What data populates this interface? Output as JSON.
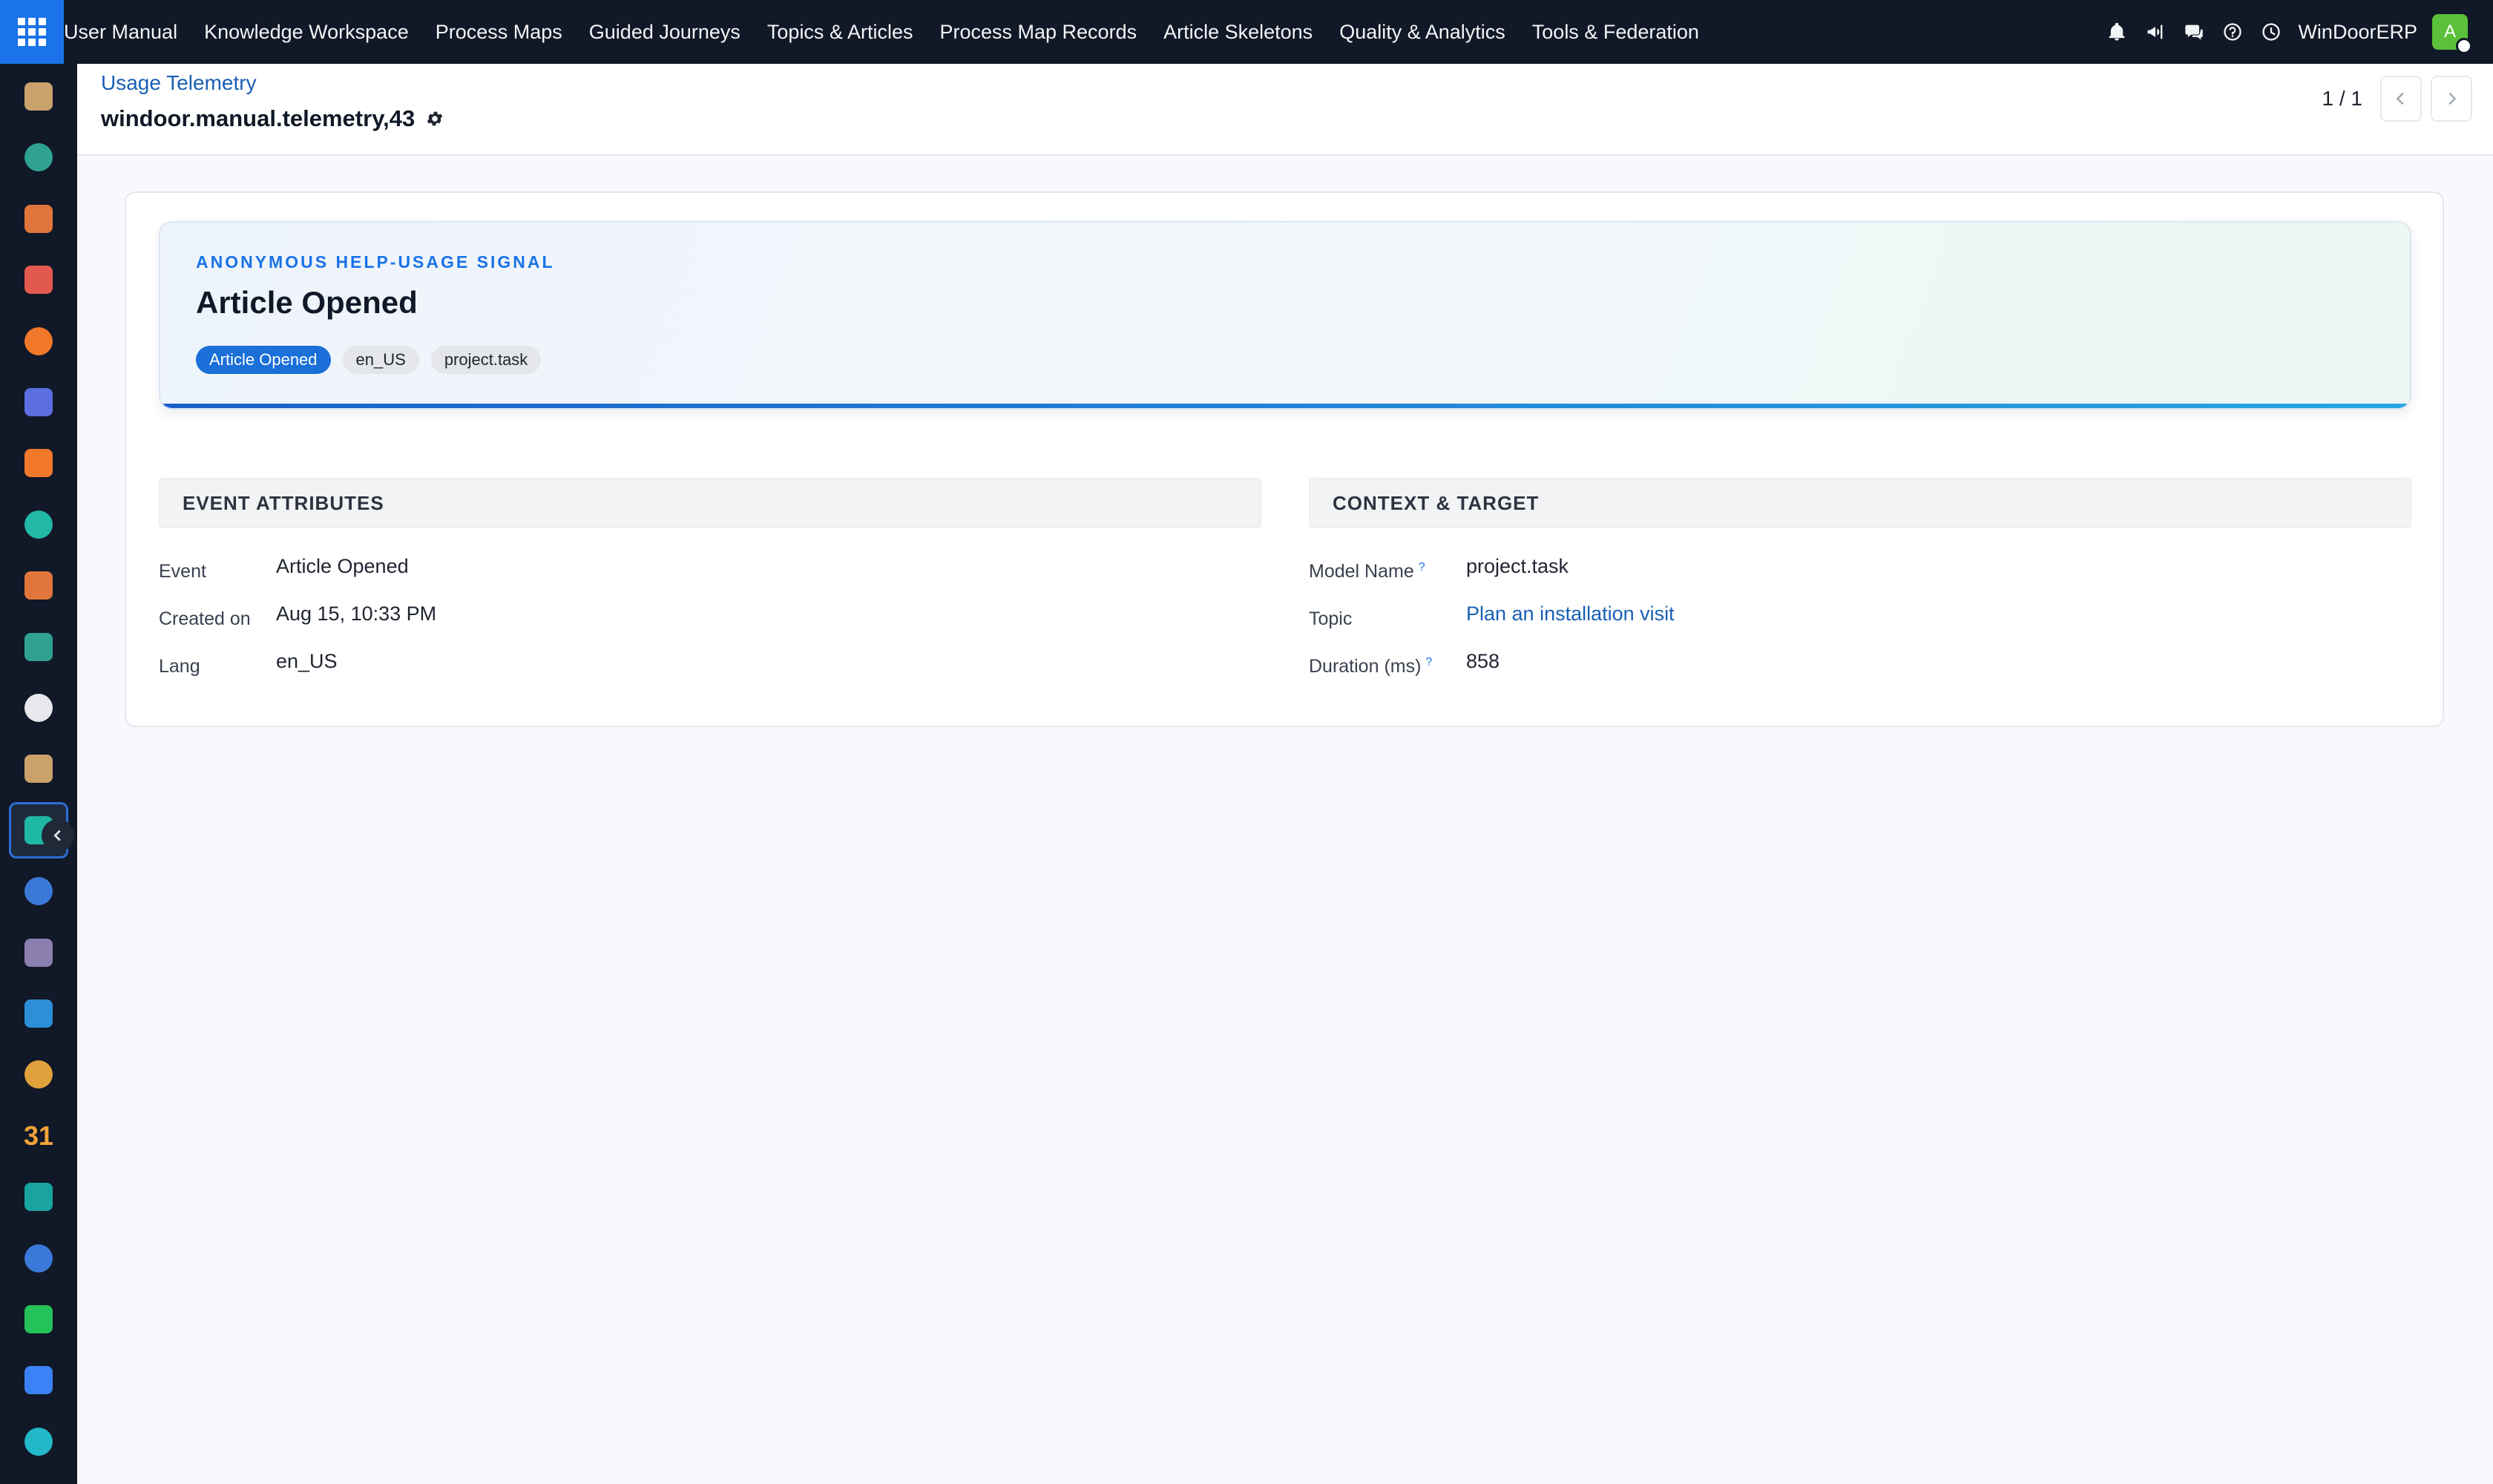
{
  "topbar": {
    "apps_icon": "apps-grid-icon",
    "brand": "User Manual",
    "menu": [
      {
        "label": "Knowledge Workspace"
      },
      {
        "label": "Process Maps"
      },
      {
        "label": "Guided Journeys"
      },
      {
        "label": "Topics & Articles"
      },
      {
        "label": "Process Map Records"
      },
      {
        "label": "Article Skeletons"
      },
      {
        "label": "Quality & Analytics"
      },
      {
        "label": "Tools & Federation"
      }
    ],
    "systray_icons": [
      "bell-icon",
      "megaphone-icon",
      "chat-icon",
      "help-icon",
      "clock-icon"
    ],
    "company": "WinDoorERP",
    "avatar_letter": "A",
    "avatar_color": "#5cc13a"
  },
  "rail": {
    "items": [
      {
        "name": "rail-app-1",
        "color": "#c9a26b"
      },
      {
        "name": "rail-app-2",
        "color": "#2fa38f"
      },
      {
        "name": "rail-app-3",
        "color": "#e0763c"
      },
      {
        "name": "rail-app-4",
        "color": "#e25a4f"
      },
      {
        "name": "rail-app-5",
        "color": "#f2782a"
      },
      {
        "name": "rail-app-6",
        "color": "#5b6fe0"
      },
      {
        "name": "rail-app-7",
        "color": "#f2782a"
      },
      {
        "name": "rail-app-8",
        "color": "#22b8a8"
      },
      {
        "name": "rail-app-9",
        "color": "#e0763c"
      },
      {
        "name": "rail-app-10",
        "color": "#2fa38f"
      },
      {
        "name": "rail-app-11",
        "color": "#e8e8ec"
      },
      {
        "name": "rail-app-12",
        "color": "#c9a26b"
      },
      {
        "name": "rail-app-13",
        "color": "#1fb7a6"
      },
      {
        "name": "rail-app-14",
        "color": "#3a79d8"
      },
      {
        "name": "rail-app-15",
        "color": "#8b7fb0"
      },
      {
        "name": "rail-app-16",
        "color": "#2d8fd8"
      },
      {
        "name": "rail-app-17",
        "color": "#e0a13c"
      },
      {
        "name": "rail-app-18",
        "color": "#f2a33a"
      },
      {
        "name": "rail-app-19",
        "color": "#19a4a0"
      },
      {
        "name": "rail-app-20",
        "color": "#3a79d8"
      },
      {
        "name": "rail-app-21",
        "color": "#25c25a"
      },
      {
        "name": "rail-app-22",
        "color": "#3b82f6"
      },
      {
        "name": "rail-app-23",
        "color": "#22b8c8"
      }
    ],
    "calendar_glyph": "31",
    "active_index": 12
  },
  "control": {
    "breadcrumb": "Usage Telemetry",
    "record_title": "windoor.manual.telemetry,43",
    "pager_value": "1 / 1"
  },
  "hero": {
    "kicker": "ANONYMOUS HELP-USAGE SIGNAL",
    "title": "Article Opened",
    "tags": [
      "Article Opened",
      "en_US",
      "project.task"
    ]
  },
  "groups": {
    "left": {
      "title": "EVENT ATTRIBUTES",
      "fields": [
        {
          "label": "Event",
          "value": "Article Opened"
        },
        {
          "label": "Created on",
          "value": "Aug 15, 10:33 PM"
        },
        {
          "label": "Lang",
          "value": "en_US"
        }
      ]
    },
    "right": {
      "title": "CONTEXT & TARGET",
      "fields": [
        {
          "label": "Model Name",
          "help": "?",
          "value": "project.task"
        },
        {
          "label": "Topic",
          "value": "Plan an installation visit"
        },
        {
          "label": "Duration (ms)",
          "help": "?",
          "value": "858"
        }
      ]
    }
  },
  "colors": {
    "accent": "#1a73e8",
    "nav_bg": "#111827",
    "link": "#1a5fb4"
  }
}
